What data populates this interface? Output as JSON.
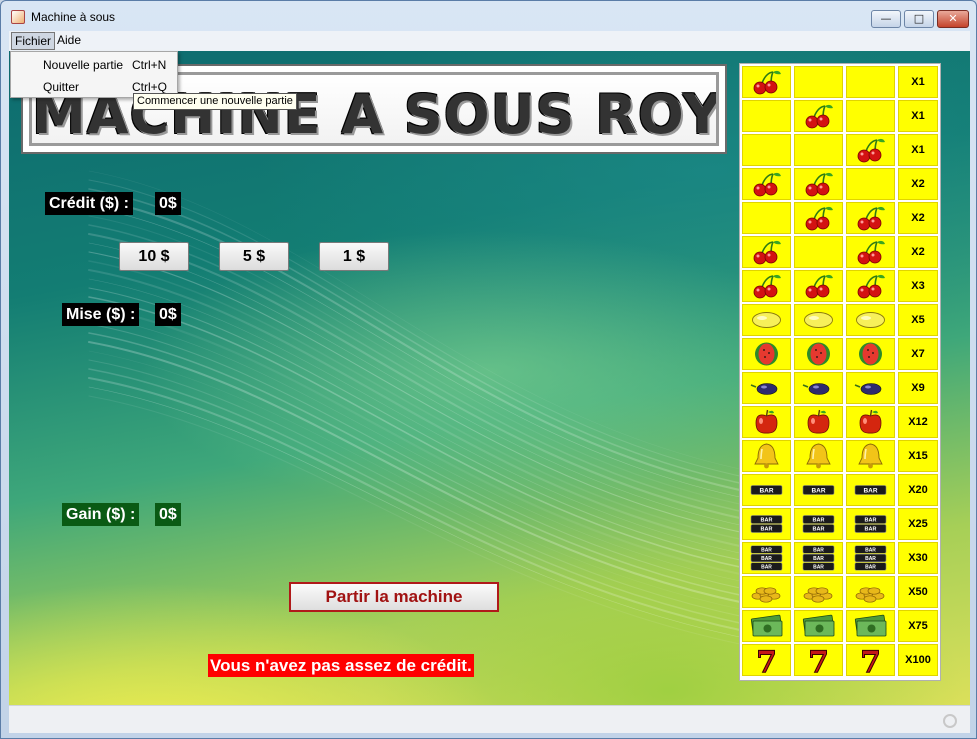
{
  "window": {
    "title": "Machine à sous",
    "app_icon": "java-cup-icon",
    "controls": [
      "minimize-icon",
      "maximize-icon",
      "close-icon"
    ]
  },
  "menubar": {
    "items": [
      "Fichier",
      "Aide"
    ],
    "open_menu": "Fichier"
  },
  "fichier_menu": {
    "items": [
      {
        "label": "Nouvelle partie",
        "accelerator": "Ctrl+N"
      },
      {
        "label": "Quitter",
        "accelerator": "Ctrl+Q"
      }
    ]
  },
  "tooltip": "Commencer une nouvelle partie",
  "banner": {
    "text": "MACHINE A SOUS ROYALE"
  },
  "credit": {
    "label": "Crédit ($) :",
    "value": "0$"
  },
  "bets": {
    "coin_10": "10 $",
    "coin_5": "5 $",
    "coin_1": "1 $"
  },
  "mise": {
    "label": "Mise ($) :",
    "value": "0$"
  },
  "gain": {
    "label": "Gain ($) :",
    "value": "0$"
  },
  "spin_button": "Partir la machine",
  "message": "Vous n'avez pas assez de crédit.",
  "colors": {
    "cell": "#ffff00",
    "message_bg": "#ff0000",
    "spin_text": "#a11212",
    "gain_bg": "#0a5a14"
  },
  "paytable": [
    {
      "symbols": [
        "cherry",
        "",
        ""
      ],
      "mult": "X1"
    },
    {
      "symbols": [
        "",
        "cherry",
        ""
      ],
      "mult": "X1"
    },
    {
      "symbols": [
        "",
        "",
        "cherry"
      ],
      "mult": "X1"
    },
    {
      "symbols": [
        "cherry",
        "cherry",
        ""
      ],
      "mult": "X2"
    },
    {
      "symbols": [
        "",
        "cherry",
        "cherry"
      ],
      "mult": "X2"
    },
    {
      "symbols": [
        "cherry",
        "",
        "cherry"
      ],
      "mult": "X2"
    },
    {
      "symbols": [
        "cherry",
        "cherry",
        "cherry"
      ],
      "mult": "X3"
    },
    {
      "symbols": [
        "lemon",
        "lemon",
        "lemon"
      ],
      "mult": "X5"
    },
    {
      "symbols": [
        "watermelon",
        "watermelon",
        "watermelon"
      ],
      "mult": "X7"
    },
    {
      "symbols": [
        "plum",
        "plum",
        "plum"
      ],
      "mult": "X9"
    },
    {
      "symbols": [
        "apple",
        "apple",
        "apple"
      ],
      "mult": "X12"
    },
    {
      "symbols": [
        "bell",
        "bell",
        "bell"
      ],
      "mult": "X15"
    },
    {
      "symbols": [
        "bar1",
        "bar1",
        "bar1"
      ],
      "mult": "X20"
    },
    {
      "symbols": [
        "bar2",
        "bar2",
        "bar2"
      ],
      "mult": "X25"
    },
    {
      "symbols": [
        "bar3",
        "bar3",
        "bar3"
      ],
      "mult": "X30"
    },
    {
      "symbols": [
        "coins",
        "coins",
        "coins"
      ],
      "mult": "X50"
    },
    {
      "symbols": [
        "money",
        "money",
        "money"
      ],
      "mult": "X75"
    },
    {
      "symbols": [
        "seven",
        "seven",
        "seven"
      ],
      "mult": "X100"
    }
  ],
  "bar_label": "BAR",
  "seven_label": "7"
}
